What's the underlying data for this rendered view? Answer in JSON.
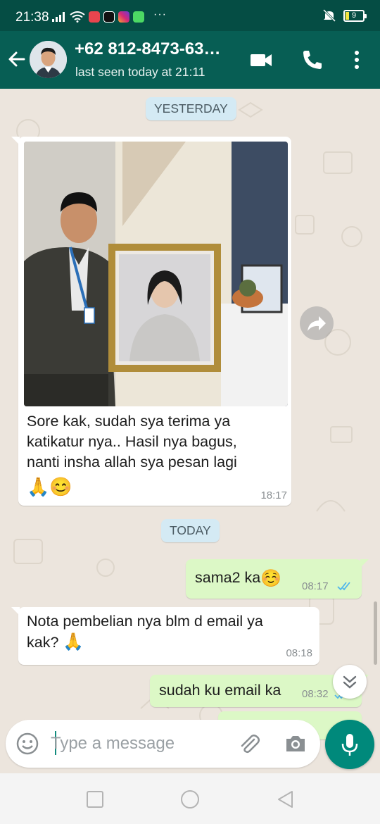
{
  "status_bar": {
    "time": "21:38",
    "dots": "···",
    "battery": "9"
  },
  "header": {
    "contact_name": "+62 812-8473-63…",
    "contact_status": "last seen today at 21:11",
    "icons": [
      "back-arrow-icon",
      "video-call-icon",
      "phone-call-icon",
      "more-options-icon"
    ]
  },
  "chat": {
    "date_yesterday": "YESTERDAY",
    "date_today": "TODAY",
    "messages": [
      {
        "direction": "incoming",
        "has_photo": true,
        "lines": [
          "Sore kak, sudah sya terima ya",
          "katikatur nya.. Hasil nya bagus,",
          "nanti insha allah sya pesan lagi"
        ],
        "emoji": "🙏😊",
        "time": "18:17"
      },
      {
        "direction": "outgoing",
        "text": "sama2 ka",
        "emoji": "☺️",
        "time": "08:17",
        "read": true
      },
      {
        "direction": "incoming",
        "lines": [
          "Nota pembelian nya blm d email ya",
          "kak?"
        ],
        "emoji": "🙏",
        "time": "08:18"
      },
      {
        "direction": "outgoing",
        "text": "sudah ku email ka",
        "time": "08:32",
        "read": true
      }
    ]
  },
  "input": {
    "placeholder": "Type a message"
  },
  "colors": {
    "header": "#075e54",
    "status_bar": "#054d44",
    "chat_bg": "#ece5dd",
    "outgoing_bubble": "#dcf8c6",
    "incoming_bubble": "#ffffff",
    "date_chip": "#d4eaf4",
    "mic_button": "#00897b",
    "read_ticks": "#4fb6ec"
  }
}
